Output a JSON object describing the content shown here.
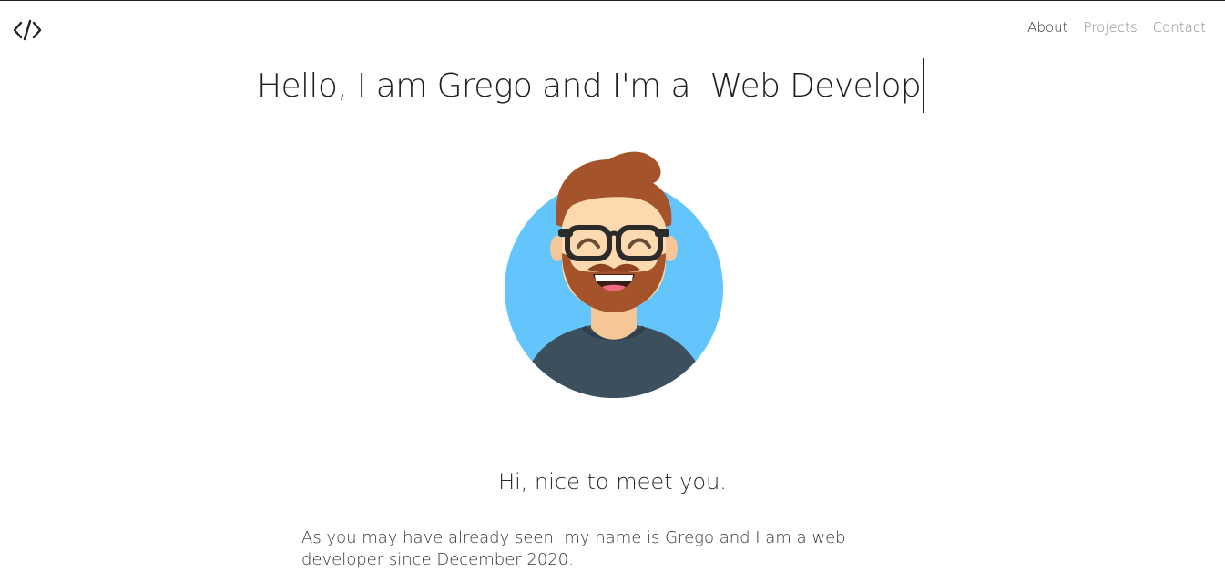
{
  "header": {
    "logo_icon": "code-brackets-icon",
    "nav": [
      {
        "label": "About",
        "active": true
      },
      {
        "label": "Projects",
        "active": false
      },
      {
        "label": "Contact",
        "active": false
      }
    ]
  },
  "hero": {
    "typed_text": "Hello, I am Grego and I'm a  Web Develop",
    "avatar_icon": "bearded-developer-avatar-icon"
  },
  "about": {
    "greeting": "Hi, nice to meet you.",
    "intro": "As you may have already seen, my name is Grego and I am a web developer since December 2020."
  },
  "colors": {
    "avatar_bg": "#64c5fd",
    "shirt": "#3b4f5d",
    "hair": "#a5532a",
    "skin": "#fcd9ae"
  }
}
